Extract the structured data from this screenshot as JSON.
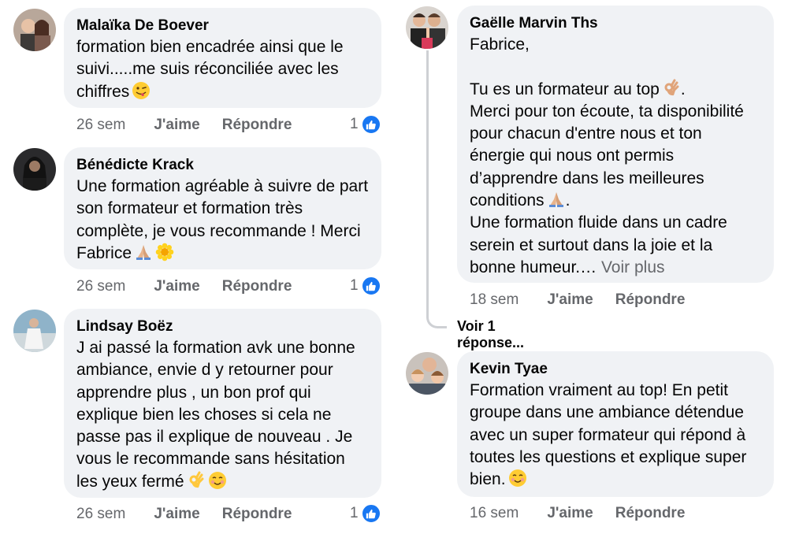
{
  "comments": [
    {
      "author": "Malaïka De Boever",
      "text": "formation bien encadrée ainsi que le suivi.....me suis réconciliée avec les chiffres",
      "time": "26 sem",
      "like_label": "J'aime",
      "reply_label": "Répondre",
      "reactions": "1"
    },
    {
      "author": "Bénédicte Krack",
      "text": "Une formation agréable à suivre de part son formateur et formation très complète, je vous recommande ! Merci Fabrice",
      "time": "26 sem",
      "like_label": "J'aime",
      "reply_label": "Répondre",
      "reactions": "1"
    },
    {
      "author": "Lindsay Boëz",
      "text": "J ai passé la formation avk une bonne ambiance, envie d y retourner pour apprendre plus , un bon prof qui explique bien les choses si cela ne passe pas il explique de nouveau . Je vous le recommande sans hésitation les yeux fermé",
      "time": "26 sem",
      "like_label": "J'aime",
      "reply_label": "Répondre",
      "reactions": "1"
    },
    {
      "author": "Gaëlle Marvin Ths",
      "line1": "Fabrice,",
      "line2": "Tu es un formateur au top",
      "line3": "Merci pour ton écoute, ta disponibilité pour chacun d'entre nous et ton énergie qui nous ont permis d’apprendre dans les meilleures conditions",
      "line4": "Une formation fluide dans un cadre serein et surtout dans la joie et la bonne humeur.…",
      "see_more": "Voir plus",
      "time": "18 sem",
      "like_label": "J'aime",
      "reply_label": "Répondre",
      "replies": "Voir 1 réponse..."
    },
    {
      "author": "Kevin Tyae",
      "text": "Formation vraiment au top! En petit groupe dans une ambiance détendue avec un super formateur qui répond à toutes les questions et explique super bien.",
      "time": "16 sem",
      "like_label": "J'aime",
      "reply_label": "Répondre"
    }
  ],
  "colors": {
    "bubble": "#f0f2f5",
    "meta_text": "#65676b",
    "like_blue": "#1877f2",
    "thread_line": "#ced0d4"
  },
  "icons": [
    "wink-tongue-emoji",
    "praying-hands-emoji",
    "sunflower-emoji",
    "ok-hand-emoji",
    "smiling-blush-emoji",
    "like-thumb-icon"
  ]
}
